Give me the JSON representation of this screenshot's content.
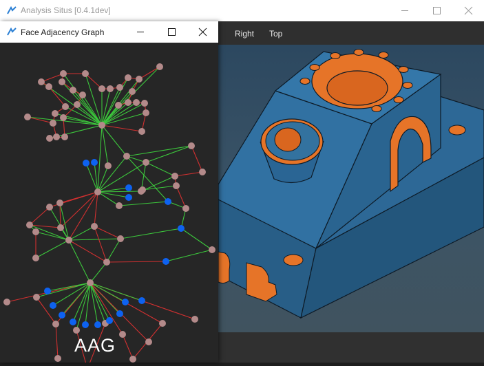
{
  "app": {
    "title": "Analysis Situs [0.4.1dev]"
  },
  "graph_window": {
    "title": "Face Adjacency Graph",
    "label": "AAG"
  },
  "toolbar": {
    "right_label": "Right",
    "top_label": "Top"
  },
  "colors": {
    "node_face": "#b38a8a",
    "node_highlight": "#0e62f0",
    "edge_convex": "#3cc83c",
    "edge_concave": "#d23030",
    "part_body": "#2f6a9a",
    "part_feature": "#e7772b"
  }
}
